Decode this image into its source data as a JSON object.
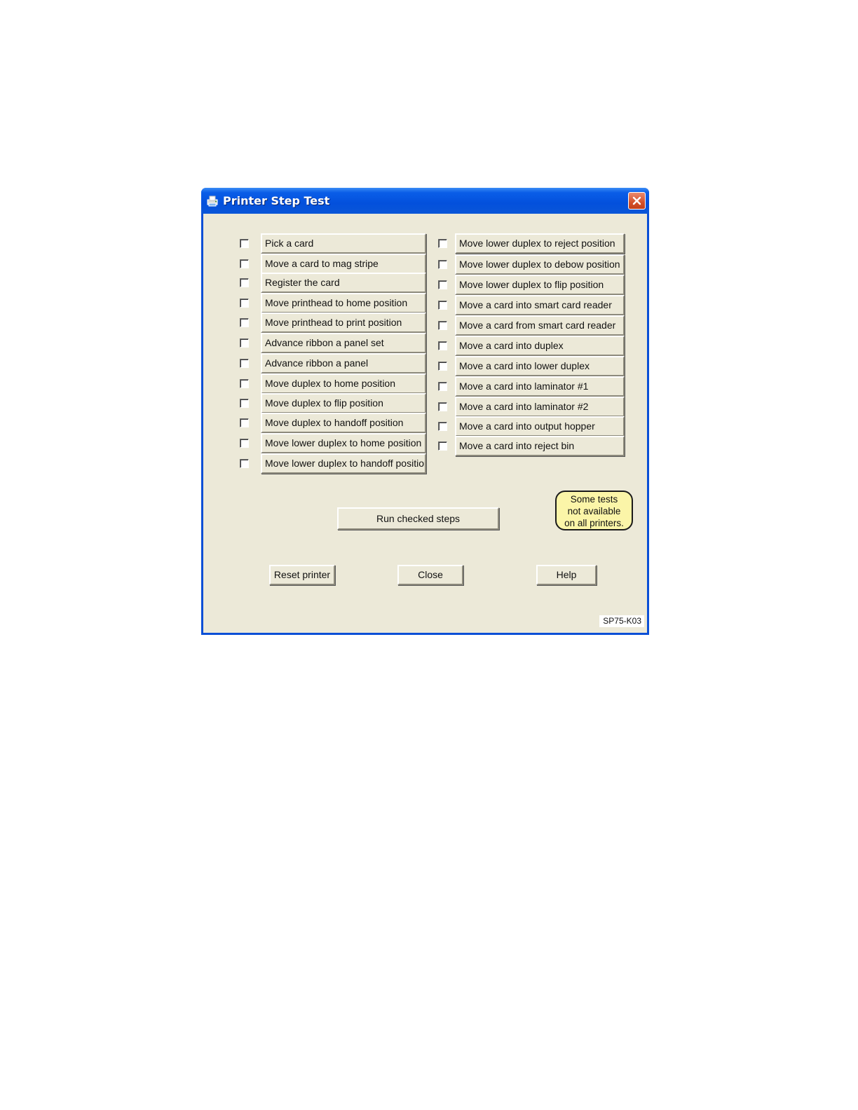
{
  "window": {
    "title": "Printer Step Test",
    "colors": {
      "titlebar": "#0350dc",
      "face": "#ece9d8",
      "note": "#fbf5a8"
    }
  },
  "left_steps": [
    {
      "label": "Pick a card",
      "checked": false
    },
    {
      "label": "Move a card to mag stripe",
      "checked": false
    },
    {
      "label": "Register the card",
      "checked": false
    },
    {
      "label": "Move printhead to home position",
      "checked": false
    },
    {
      "label": "Move printhead to print position",
      "checked": false
    },
    {
      "label": "Advance ribbon a panel set",
      "checked": false
    },
    {
      "label": "Advance ribbon a panel",
      "checked": false
    },
    {
      "label": "Move duplex to home position",
      "checked": false
    },
    {
      "label": "Move duplex to flip position",
      "checked": false
    },
    {
      "label": "Move duplex to handoff position",
      "checked": false
    },
    {
      "label": "Move lower duplex to home position",
      "checked": false
    },
    {
      "label": "Move lower duplex to handoff position",
      "checked": false
    }
  ],
  "right_steps": [
    {
      "label": "Move lower duplex to reject position",
      "checked": false
    },
    {
      "label": "Move lower duplex to debow position",
      "checked": false
    },
    {
      "label": "Move lower duplex to flip position",
      "checked": false
    },
    {
      "label": "Move a card into smart card reader",
      "checked": false
    },
    {
      "label": "Move a card from smart card reader",
      "checked": false
    },
    {
      "label": "Move a card into duplex",
      "checked": false
    },
    {
      "label": "Move a card into lower duplex",
      "checked": false
    },
    {
      "label": "Move a card into laminator #1",
      "checked": false
    },
    {
      "label": "Move a card into laminator #2",
      "checked": false
    },
    {
      "label": "Move a card into output hopper",
      "checked": false
    },
    {
      "label": "Move a card into reject bin",
      "checked": false
    }
  ],
  "run_button": "Run checked steps",
  "note_lines": [
    "Some tests",
    "not available",
    "on all printers."
  ],
  "buttons": {
    "reset": "Reset printer",
    "close": "Close",
    "help": "Help"
  },
  "figure_code": "SP75-K03",
  "icons": {
    "title": "printer-icon",
    "close": "close-icon"
  }
}
